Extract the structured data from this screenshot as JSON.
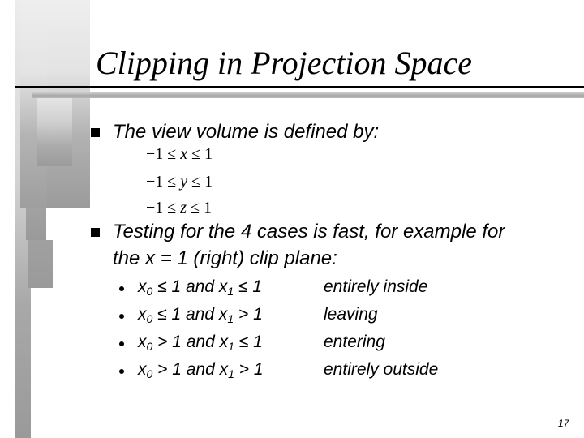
{
  "slide": {
    "title": "Clipping in Projection Space",
    "page_number": "17"
  },
  "bullets": [
    {
      "text": "The view volume is defined by:",
      "math": [
        {
          "lhs": "−1 ≤ ",
          "var": "x",
          "rhs": " ≤ 1"
        },
        {
          "lhs": "−1 ≤ ",
          "var": "y",
          "rhs": " ≤ 1"
        },
        {
          "lhs": "−1 ≤ ",
          "var": "z",
          "rhs": " ≤ 1"
        }
      ]
    },
    {
      "text_line1": "Testing for the 4 cases is fast, for example for",
      "text_line2": "the x = 1 (right) clip plane:",
      "cases": [
        {
          "x0_op": " ≤ 1 and x",
          "x1_op": " ≤ 1",
          "result": "entirely inside"
        },
        {
          "x0_op": " ≤ 1 and x",
          "x1_op": " > 1",
          "result": "leaving"
        },
        {
          "x0_op": " > 1 and x",
          "x1_op": " ≤ 1",
          "result": "entering"
        },
        {
          "x0_op": " > 1 and x",
          "x1_op": " > 1",
          "result": "entirely outside"
        }
      ],
      "var_name": "x",
      "sub0": "0",
      "sub1": "1"
    }
  ],
  "colors": {
    "bar_light": "#ececec",
    "bar_dark": "#9a9a9a",
    "rule": "#000000"
  }
}
